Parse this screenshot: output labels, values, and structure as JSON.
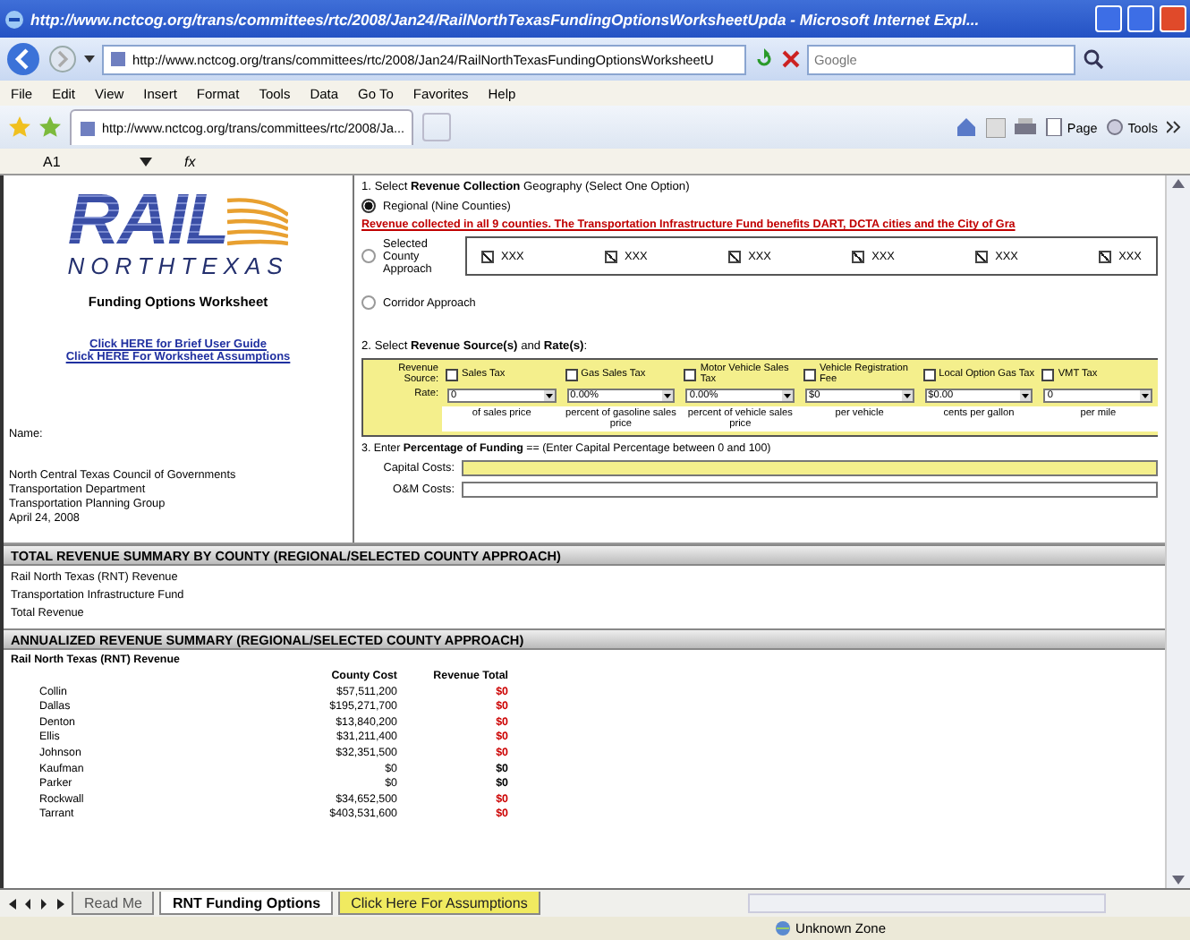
{
  "window": {
    "title": "http://www.nctcog.org/trans/committees/rtc/2008/Jan24/RailNorthTexasFundingOptionsWorksheetUpda - Microsoft Internet Expl...",
    "address": "http://www.nctcog.org/trans/committees/rtc/2008/Jan24/RailNorthTexasFundingOptionsWorksheetU",
    "search_placeholder": "Google"
  },
  "menu": [
    "File",
    "Edit",
    "View",
    "Insert",
    "Format",
    "Tools",
    "Data",
    "Go To",
    "Favorites",
    "Help"
  ],
  "favorites_bar": {
    "tab": "http://www.nctcog.org/trans/committees/rtc/2008/Ja...",
    "buttons": [
      "Page",
      "Tools"
    ]
  },
  "formula_bar": {
    "cell": "A1",
    "fx": "fx"
  },
  "left_panel": {
    "logo_top": "RAIL",
    "logo_bottom": "NORTHTEXAS",
    "title": "Funding Options Worksheet",
    "links": [
      "Click HERE for Brief User Guide",
      "Click HERE For Worksheet Assumptions"
    ],
    "name_label": "Name:",
    "org_lines": [
      "North Central Texas Council of Governments",
      "Transportation Department",
      "Transportation Planning Group",
      "April 24, 2008"
    ]
  },
  "section1": {
    "heading": "1. Select **Revenue Collection** Geography (Select One Option)",
    "options": [
      {
        "label": "Regional (Nine Counties)",
        "selected": true
      },
      {
        "label": "Selected County Approach",
        "selected": false
      },
      {
        "label": "Corridor Approach",
        "selected": false
      }
    ],
    "note": "Revenue collected in all 9 counties.  The Transportation Infrastructure Fund benefits DART, DCTA cities and the City of Gra",
    "counties": [
      {
        "label": "XXX",
        "checked": true
      },
      {
        "label": "XXX",
        "checked": true
      },
      {
        "label": "XXX",
        "checked": true
      },
      {
        "label": "XXX",
        "checked": true
      },
      {
        "label": "XXX",
        "checked": true
      },
      {
        "label": "XXX",
        "checked": true
      }
    ]
  },
  "section2": {
    "heading": "2. Select **Revenue Source(s)** and **Rate(s)**:",
    "source_label": "Revenue Source:",
    "rate_label": "Rate:",
    "sources": [
      {
        "name": "Sales Tax",
        "checked": false,
        "rate": "0",
        "unit": "of sales price"
      },
      {
        "name": "Gas Sales Tax",
        "checked": false,
        "rate": "0.00%",
        "unit": "percent of gasoline sales price"
      },
      {
        "name": "Motor Vehicle Sales Tax",
        "checked": false,
        "rate": "0.00%",
        "unit": "percent of vehicle sales price"
      },
      {
        "name": "Vehicle Registration Fee",
        "checked": false,
        "rate": "$0",
        "unit": "per vehicle"
      },
      {
        "name": "Local Option Gas Tax",
        "checked": false,
        "rate": "$0.00",
        "unit": "cents per gallon"
      },
      {
        "name": "VMT Tax",
        "checked": false,
        "rate": "0",
        "unit": "per mile"
      }
    ]
  },
  "section3": {
    "heading": "3. Enter **Percentage of Funding** ==  (Enter Capital Percentage between 0 and 100)",
    "fields": [
      {
        "label": "Capital Costs:",
        "highlighted": true
      },
      {
        "label": "O&M Costs:",
        "highlighted": false
      }
    ]
  },
  "total_summary": {
    "heading": "TOTAL REVENUE SUMMARY BY COUNTY (REGIONAL/SELECTED COUNTY APPROACH)",
    "rows": [
      "Rail North Texas (RNT) Revenue",
      "Transportation Infrastructure Fund",
      "Total Revenue"
    ]
  },
  "annualized_summary": {
    "heading": "ANNUALIZED REVENUE SUMMARY (REGIONAL/SELECTED COUNTY APPROACH)",
    "subheading": "Rail North Texas (RNT) Revenue",
    "columns": [
      "County Cost",
      "Revenue Total"
    ],
    "rows": [
      {
        "county": "Collin",
        "cost": "$57,511,200",
        "total": "$0",
        "color": "#cc0000"
      },
      {
        "county": "Dallas",
        "cost": "$195,271,700",
        "total": "$0",
        "color": "#cc0000"
      },
      {
        "county": "Denton",
        "cost": "$13,840,200",
        "total": "$0",
        "color": "#cc0000"
      },
      {
        "county": "Ellis",
        "cost": "$31,211,400",
        "total": "$0",
        "color": "#cc0000"
      },
      {
        "county": "Johnson",
        "cost": "$32,351,500",
        "total": "$0",
        "color": "#cc0000"
      },
      {
        "county": "Kaufman",
        "cost": "$0",
        "total": "$0",
        "color": "#000000"
      },
      {
        "county": "Parker",
        "cost": "$0",
        "total": "$0",
        "color": "#000000"
      },
      {
        "county": "Rockwall",
        "cost": "$34,652,500",
        "total": "$0",
        "color": "#cc0000"
      },
      {
        "county": "Tarrant",
        "cost": "$403,531,600",
        "total": "$0",
        "color": "#cc0000"
      }
    ]
  },
  "sheet_tabs": [
    {
      "label": "Read Me",
      "selected": false,
      "highlighted": false
    },
    {
      "label": "RNT Funding Options",
      "selected": true,
      "highlighted": false
    },
    {
      "label": "Click Here For Assumptions",
      "selected": false,
      "highlighted": true
    }
  ],
  "status_bar": {
    "zone": "Unknown Zone"
  }
}
